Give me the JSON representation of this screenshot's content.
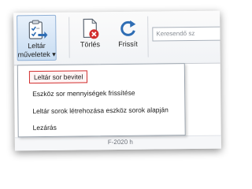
{
  "toolbar": {
    "actions_button": {
      "line1": "Leltár",
      "line2": "műveletek",
      "arrow": "▾",
      "icon": "clipboard-check-arrow-icon"
    },
    "delete_button": {
      "label": "Törlés",
      "icon": "document-delete-icon"
    },
    "refresh_button": {
      "label": "Frissít",
      "icon": "refresh-icon"
    },
    "search": {
      "placeholder": "Keresendő sz"
    }
  },
  "menu": {
    "items": [
      {
        "label": "Leltár sor bevitel",
        "highlighted": true
      },
      {
        "label": "Eszköz sor mennyiségek frissítése"
      },
      {
        "label": "Leltár sorok létrehozása eszköz sorok alapján"
      },
      {
        "label": "Lezárás"
      }
    ],
    "highlight_color": "#d22e2e"
  },
  "background": {
    "snippet": "F-2020 h"
  },
  "colors": {
    "accent": "#2e6db4",
    "delete_red": "#d22e2e",
    "active_button": "#c7dcf2"
  }
}
